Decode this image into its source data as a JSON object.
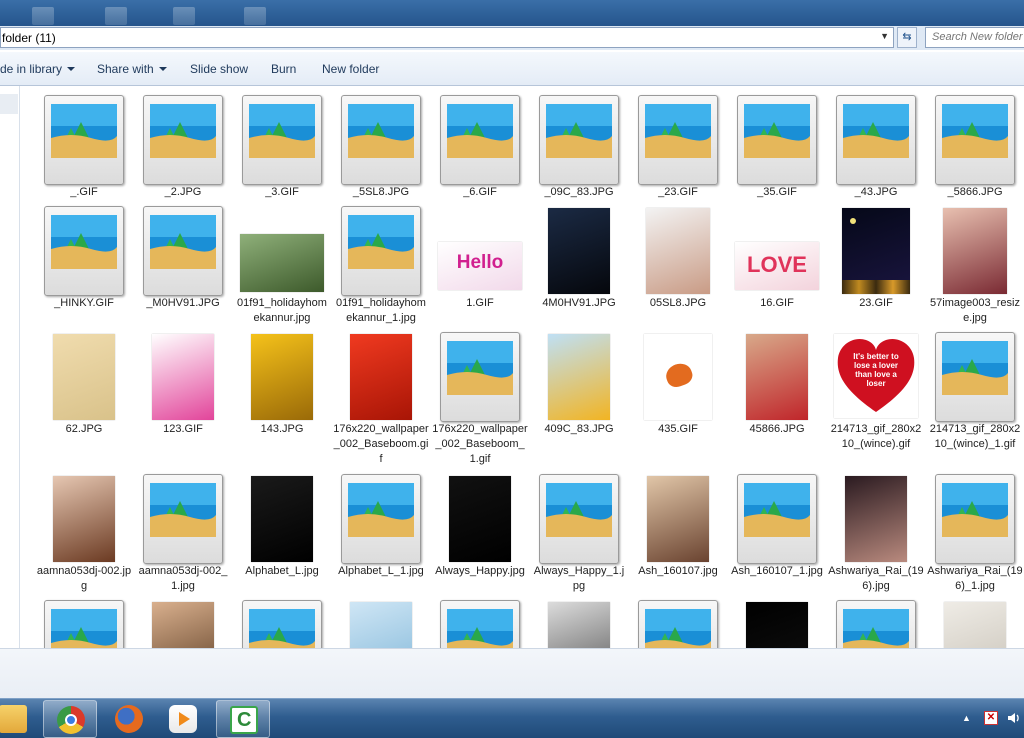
{
  "address": {
    "path": "folder (11)",
    "search_placeholder": "Search New folder"
  },
  "toolbar": {
    "include_in_library": "de in library",
    "share_with": "Share with",
    "slide_show": "Slide show",
    "burn": "Burn",
    "new_folder": "New folder"
  },
  "files": [
    {
      "name": "_.GIF",
      "thumb": "placeholder"
    },
    {
      "name": "_2.JPG",
      "thumb": "placeholder"
    },
    {
      "name": "_3.GIF",
      "thumb": "placeholder"
    },
    {
      "name": "_5SL8.JPG",
      "thumb": "placeholder"
    },
    {
      "name": "_6.GIF",
      "thumb": "placeholder"
    },
    {
      "name": "_09C_83.JPG",
      "thumb": "placeholder"
    },
    {
      "name": "_23.GIF",
      "thumb": "placeholder"
    },
    {
      "name": "_35.GIF",
      "thumb": "placeholder"
    },
    {
      "name": "_43.JPG",
      "thumb": "placeholder"
    },
    {
      "name": "_5866.JPG",
      "thumb": "placeholder"
    },
    {
      "name": "_HINKY.GIF",
      "thumb": "placeholder"
    },
    {
      "name": "_M0HV91.JPG",
      "thumb": "placeholder"
    },
    {
      "name": "01f91_holidayhomekannur.jpg",
      "thumb": "photo",
      "colors": [
        "#8fb07a",
        "#3d5a2b"
      ],
      "shape": "wide"
    },
    {
      "name": "01f91_holidayhomekannur_1.jpg",
      "thumb": "placeholder"
    },
    {
      "name": "1.GIF",
      "thumb": "photo",
      "colors": [
        "#ffffff",
        "#f2d9ea"
      ],
      "shape": "hello",
      "text": "Hello"
    },
    {
      "name": "4M0HV91.JPG",
      "thumb": "photo",
      "colors": [
        "#1b2a44",
        "#05070c"
      ],
      "shape": "tall"
    },
    {
      "name": "05SL8.JPG",
      "thumb": "photo",
      "colors": [
        "#f3f3f3",
        "#c99b85"
      ],
      "shape": "portrait"
    },
    {
      "name": "16.GIF",
      "thumb": "photo",
      "colors": [
        "#ffffff",
        "#f3d3dc"
      ],
      "shape": "love",
      "text": "LOVE"
    },
    {
      "name": "23.GIF",
      "thumb": "photo",
      "colors": [
        "#050818",
        "#1a1540"
      ],
      "shape": "night"
    },
    {
      "name": "57image003_resize.jpg",
      "thumb": "photo",
      "colors": [
        "#e8c0b0",
        "#7a2a33"
      ],
      "shape": "portrait"
    },
    {
      "name": "62.JPG",
      "thumb": "photo",
      "colors": [
        "#f0dcae",
        "#d9c28a"
      ],
      "shape": "tall"
    },
    {
      "name": "123.GIF",
      "thumb": "photo",
      "colors": [
        "#ffffff",
        "#e2449a"
      ],
      "shape": "tall"
    },
    {
      "name": "143.JPG",
      "thumb": "photo",
      "colors": [
        "#f5c21a",
        "#9a6a08"
      ],
      "shape": "tall"
    },
    {
      "name": "176x220_wallpaper_002_Baseboom.gif",
      "thumb": "photo",
      "colors": [
        "#f03a20",
        "#a81506"
      ],
      "shape": "tall"
    },
    {
      "name": "176x220_wallpaper_002_Baseboom_1.gif",
      "thumb": "placeholder"
    },
    {
      "name": "409C_83.JPG",
      "thumb": "photo",
      "colors": [
        "#bfe0f5",
        "#f2b422"
      ],
      "shape": "tall"
    },
    {
      "name": "435.GIF",
      "thumb": "photo",
      "colors": [
        "#ffffff",
        "#e36b1f"
      ],
      "shape": "butterfly"
    },
    {
      "name": "45866.JPG",
      "thumb": "photo",
      "colors": [
        "#d8a98a",
        "#c0252a"
      ],
      "shape": "tall"
    },
    {
      "name": "214713_gif_280x210_(wince).gif",
      "thumb": "photo",
      "colors": [
        "#ffffff",
        "#cf1020"
      ],
      "shape": "heart",
      "text": "It's better to lose a lover than love a loser"
    },
    {
      "name": "214713_gif_280x210_(wince)_1.gif",
      "thumb": "placeholder"
    },
    {
      "name": "aamna053dj-002.jpg",
      "thumb": "photo",
      "colors": [
        "#e6c7b2",
        "#6b3a22"
      ],
      "shape": "tall"
    },
    {
      "name": "aamna053dj-002_1.jpg",
      "thumb": "placeholder"
    },
    {
      "name": "Alphabet_L.jpg",
      "thumb": "photo",
      "colors": [
        "#1a1a1a",
        "#000000"
      ],
      "shape": "tall"
    },
    {
      "name": "Alphabet_L_1.jpg",
      "thumb": "placeholder"
    },
    {
      "name": "Always_Happy.jpg",
      "thumb": "photo",
      "colors": [
        "#111111",
        "#000000"
      ],
      "shape": "tall"
    },
    {
      "name": "Always_Happy_1.jpg",
      "thumb": "placeholder"
    },
    {
      "name": "Ash_160107.jpg",
      "thumb": "photo",
      "colors": [
        "#e1c6a8",
        "#6a4330"
      ],
      "shape": "tall"
    },
    {
      "name": "Ash_160107_1.jpg",
      "thumb": "placeholder"
    },
    {
      "name": "Ashwariya_Rai_(196).jpg",
      "thumb": "photo",
      "colors": [
        "#2a1a20",
        "#b98a7e"
      ],
      "shape": "tall"
    },
    {
      "name": "Ashwariya_Rai_(196)_1.jpg",
      "thumb": "placeholder"
    },
    {
      "name": "",
      "thumb": "placeholder"
    },
    {
      "name": "",
      "thumb": "photo",
      "colors": [
        "#d9b08e",
        "#5a3b22"
      ],
      "shape": "tall"
    },
    {
      "name": "",
      "thumb": "placeholder"
    },
    {
      "name": "",
      "thumb": "photo",
      "colors": [
        "#cfe6f5",
        "#7fb6d8"
      ],
      "shape": "tall"
    },
    {
      "name": "",
      "thumb": "placeholder"
    },
    {
      "name": "",
      "thumb": "photo",
      "colors": [
        "#dcdcdc",
        "#555555"
      ],
      "shape": "tall"
    },
    {
      "name": "",
      "thumb": "placeholder"
    },
    {
      "name": "",
      "thumb": "photo",
      "colors": [
        "#000000",
        "#111111"
      ],
      "shape": "tall"
    },
    {
      "name": "",
      "thumb": "placeholder"
    },
    {
      "name": "",
      "thumb": "photo",
      "colors": [
        "#efece6",
        "#c7c1b6"
      ],
      "shape": "tall"
    }
  ],
  "taskbar": {
    "apps": [
      {
        "name": "start",
        "icon": "folder-icon",
        "color": "#e3b03a",
        "active": false
      },
      {
        "name": "chrome",
        "icon": "chrome-icon",
        "color": "#db3a2a",
        "active": true
      },
      {
        "name": "firefox",
        "icon": "firefox-icon",
        "color": "#e66a1e",
        "active": false
      },
      {
        "name": "media",
        "icon": "media-player-icon",
        "color": "#f08a1a",
        "active": false
      },
      {
        "name": "camtasia",
        "icon": "camtasia-icon",
        "color": "#3aa64a",
        "active": true
      }
    ]
  }
}
